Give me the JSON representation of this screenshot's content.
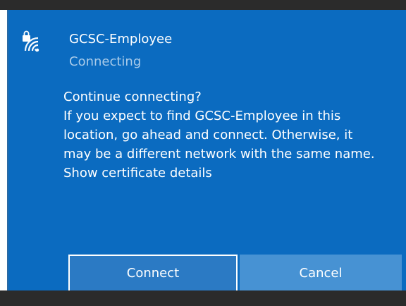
{
  "network": {
    "name": "GCSC-Employee",
    "status": "Connecting",
    "icon": "wifi-secured-icon"
  },
  "prompt": {
    "question": "Continue connecting?",
    "message": "If you expect to find GCSC-Employee in this location, go ahead and connect. Otherwise, it may be a different network with the same name.",
    "link": "Show certificate details"
  },
  "buttons": {
    "connect": "Connect",
    "cancel": "Cancel"
  },
  "colors": {
    "panel": "#0b6bc0",
    "status_text": "#a9cbe9",
    "connect_button": "#2b7ac4",
    "cancel_button": "#4792d3"
  }
}
